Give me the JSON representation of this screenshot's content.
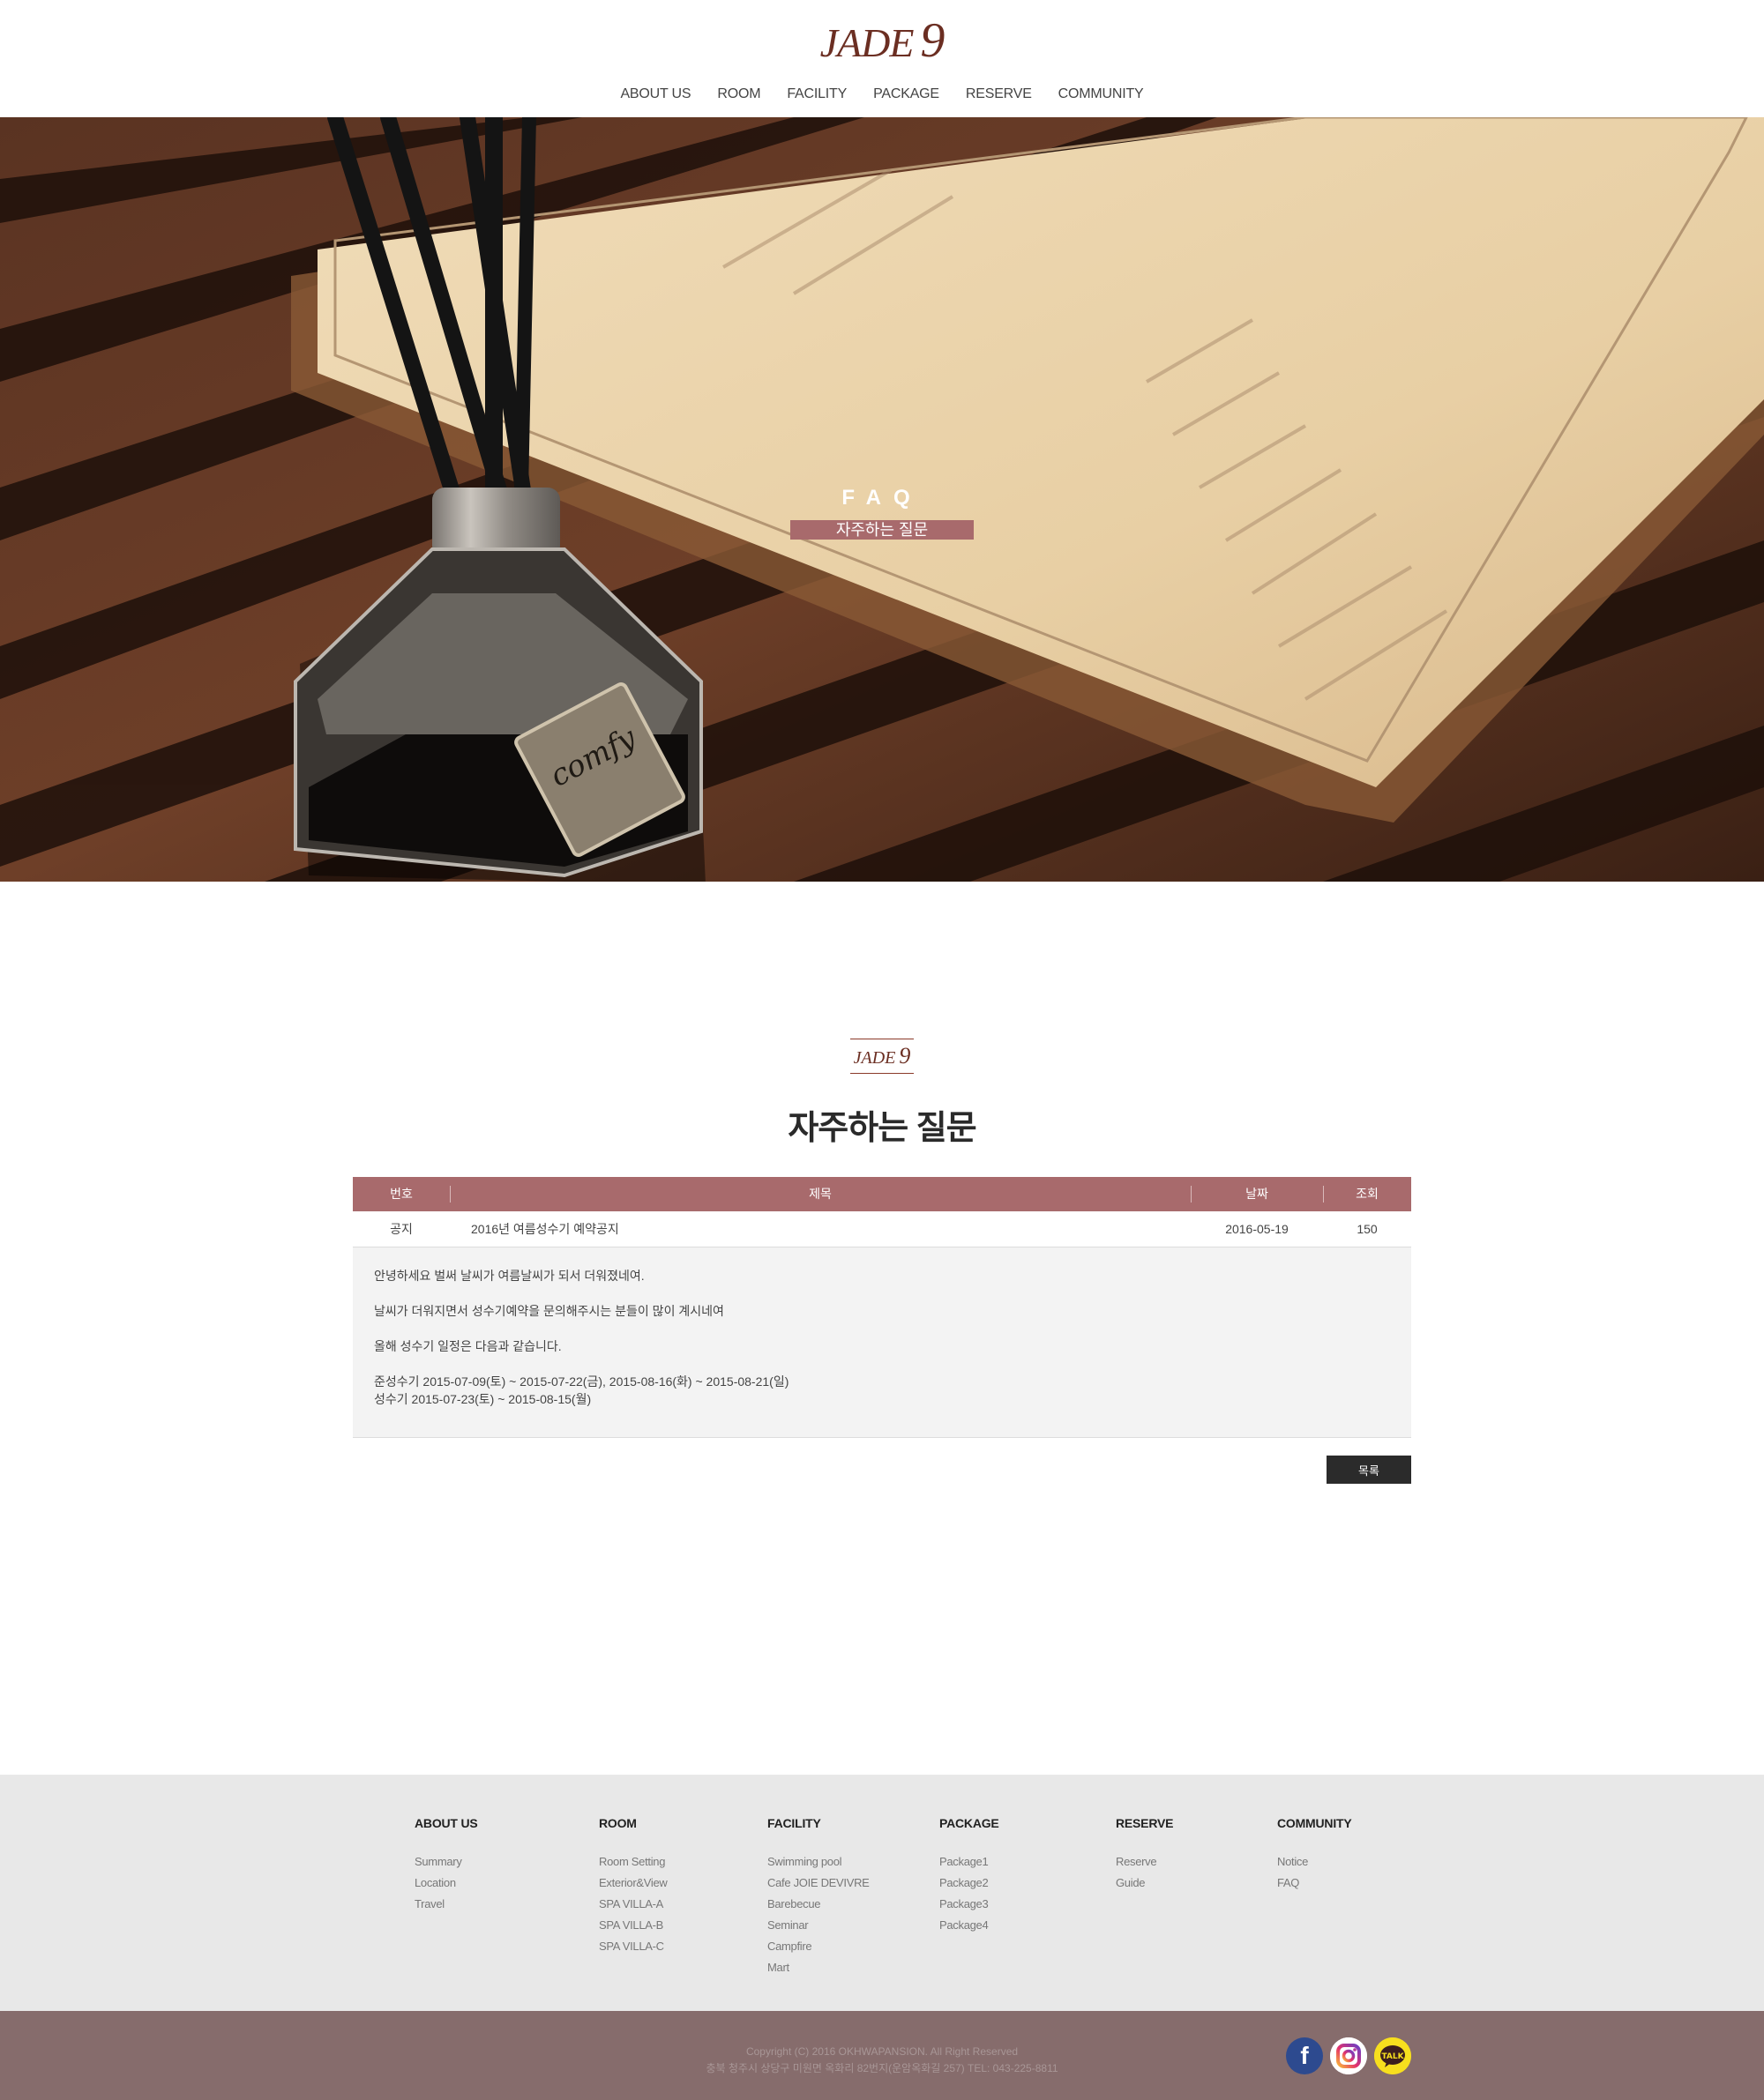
{
  "header": {
    "logo_text": "JADE",
    "logo_number": "9",
    "nav": [
      "ABOUT US",
      "ROOM",
      "FACILITY",
      "PACKAGE",
      "RESERVE",
      "COMMUNITY"
    ]
  },
  "hero": {
    "title": "FAQ",
    "subtitle": "자주하는 질문",
    "bottle_label": "comfy"
  },
  "section": {
    "logo_text": "JADE",
    "logo_number": "9",
    "title": "자주하는 질문"
  },
  "board": {
    "headers": {
      "no": "번호",
      "title": "제목",
      "date": "날짜",
      "views": "조회"
    },
    "row": {
      "no": "공지",
      "title": "2016년 여름성수기  예약공지",
      "date": "2016-05-19",
      "views": "150"
    },
    "body": [
      "안녕하세요 벌써 날씨가 여름날씨가 되서 더워졌네여.",
      "날씨가 더워지면서 성수기예약을 문의해주시는 분들이 많이 계시네여",
      "올해 성수기 일정은 다음과 같습니다.",
      "준성수기 2015-07-09(토) ~ 2015-07-22(금), 2015-08-16(화) ~ 2015-08-21(일)",
      "성수기 2015-07-23(토) ~ 2015-08-15(월)"
    ],
    "list_button": "목록"
  },
  "footer": {
    "columns": [
      {
        "title": "ABOUT US",
        "items": [
          "Summary",
          "Location",
          "Travel"
        ]
      },
      {
        "title": "ROOM",
        "items": [
          "Room Setting",
          "Exterior&View",
          "SPA VILLA-A",
          "SPA VILLA-B",
          "SPA VILLA-C"
        ]
      },
      {
        "title": "FACILITY",
        "items": [
          "Swimming pool",
          "Cafe JOIE DEVIVRE",
          "Barebecue",
          "Seminar",
          "Campfire",
          "Mart"
        ]
      },
      {
        "title": "PACKAGE",
        "items": [
          "Package1",
          "Package2",
          "Package3",
          "Package4"
        ]
      },
      {
        "title": "RESERVE",
        "items": [
          "Reserve",
          "Guide"
        ]
      },
      {
        "title": "COMMUNITY",
        "items": [
          "Notice",
          "FAQ"
        ]
      }
    ],
    "copyright": "Copyright (C) 2016 OKHWAPANSION. All Right Reserved",
    "address": "충북 청주시 상당구 미원면 옥화리 82번지(운암옥화길 257) TEL: 043-225-8811",
    "sns": {
      "facebook": "f",
      "kakao": "TALK"
    }
  },
  "colors": {
    "brand": "#6b2e22",
    "accent": "#a86a6c",
    "footer_bg": "#866c6c",
    "button_dark": "#2b2b2b"
  }
}
